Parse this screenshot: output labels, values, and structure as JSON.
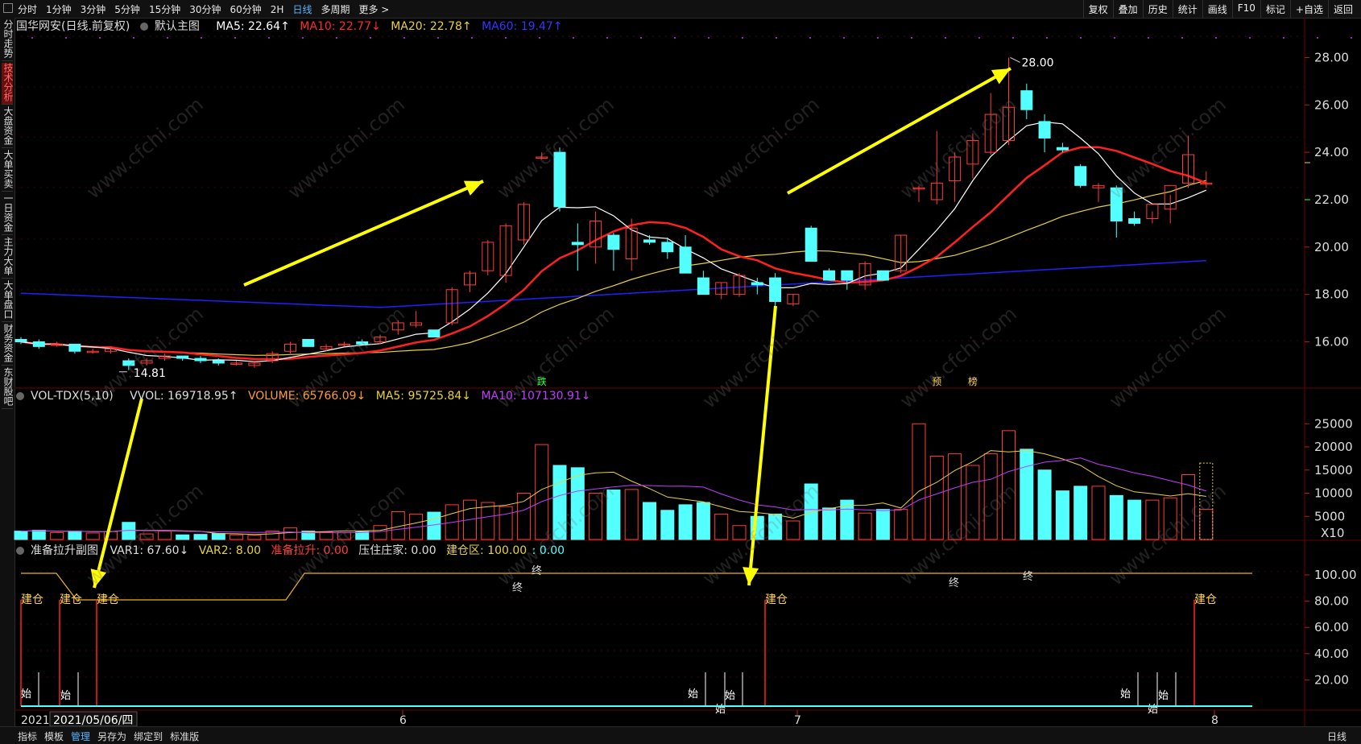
{
  "toolbar": {
    "periods": [
      "分时",
      "1分钟",
      "3分钟",
      "5分钟",
      "15分钟",
      "30分钟",
      "60分钟",
      "2H",
      "日线",
      "多周期",
      "更多 >"
    ],
    "active_period": "日线",
    "actions": [
      "复权",
      "叠加",
      "历史",
      "统计",
      "画线",
      "F10",
      "标记",
      "+自选",
      "返回"
    ]
  },
  "sidebar": {
    "items": [
      "分时走势",
      "技术分析",
      "大盘资金",
      "大单买卖",
      "一日资金",
      "主力大单",
      "大单盘口",
      "财务资金",
      "东财股吧"
    ],
    "active": "技术分析"
  },
  "main_legend": {
    "title": "国华网安(日线.前复权)",
    "template": "默认主图",
    "ma5": "MA5: 22.64↑",
    "ma10": "MA10: 22.77↓",
    "ma20": "MA20: 22.78↑",
    "ma60": "MA60: 19.47↑"
  },
  "vol_legend": {
    "name": "VOL-TDX(5,10)",
    "vvol": "VVOL: 169718.95↑",
    "volume": "VOLUME: 65766.09↓",
    "ma5": "MA5: 95725.84↓",
    "ma10": "MA10: 107130.91↓"
  },
  "sub_legend": {
    "name": "准备拉升副图",
    "var1": "VAR1: 67.60↓",
    "var2": "VAR2: 8.00",
    "zbls": "准备拉升: 0.00",
    "yzzj": "压住庄家: 0.00",
    "jcq": "建仓区: 100.00",
    "extra": ": 0.00"
  },
  "price_axis": [
    "28.00",
    "26.00",
    "24.00",
    "22.00",
    "20.00",
    "18.00",
    "16.00"
  ],
  "vol_axis": [
    "25000",
    "20000",
    "15000",
    "10000",
    "5000",
    "X10"
  ],
  "sub_axis": [
    "100.00",
    "80.00",
    "60.00",
    "40.00",
    "20.00"
  ],
  "annotations": {
    "high": "28.00",
    "low": "14.81",
    "signals": [
      {
        "text": "跌",
        "color": "#3cff3c"
      },
      {
        "text": "预",
        "color": "#ffd24a"
      },
      {
        "text": "榜",
        "color": "#ffd24a"
      }
    ],
    "build": "建仓",
    "start": "始",
    "end": "终"
  },
  "date_axis": {
    "cursor_date": "2021/05/06/四",
    "first": "2021",
    "months": [
      "6",
      "7",
      "8"
    ],
    "period_label": "日线"
  },
  "bottom_tools": [
    "指标",
    "模板",
    "管理",
    "另存为",
    "绑定到",
    "标准版"
  ],
  "bottom_active": "管理",
  "watermark": "www.cfchi.com",
  "colors": {
    "up": "#ff3b3b",
    "down": "#54ffff",
    "ma5": "#ffffff",
    "ma10": "#ff2020",
    "ma20": "#e8d23a",
    "ma60": "#2020ff",
    "arrow": "#ffff00",
    "vol_ma10": "#c03cff"
  },
  "chart_data": {
    "type": "candlestick",
    "candles": [
      [
        16.1,
        16.2,
        15.9,
        16.0
      ],
      [
        16.0,
        16.1,
        15.7,
        15.8
      ],
      [
        15.9,
        16.0,
        15.8,
        15.9
      ],
      [
        15.9,
        15.9,
        15.5,
        15.6
      ],
      [
        15.6,
        15.7,
        15.5,
        15.6
      ],
      [
        15.6,
        15.8,
        15.5,
        15.7
      ],
      [
        15.2,
        15.3,
        14.8,
        15.0
      ],
      [
        15.1,
        15.3,
        15.0,
        15.2
      ],
      [
        15.3,
        15.5,
        15.2,
        15.4
      ],
      [
        15.4,
        15.4,
        15.2,
        15.3
      ],
      [
        15.3,
        15.4,
        15.1,
        15.2
      ],
      [
        15.2,
        15.3,
        15.0,
        15.1
      ],
      [
        15.1,
        15.2,
        15.0,
        15.1
      ],
      [
        15.0,
        15.2,
        14.9,
        15.1
      ],
      [
        15.2,
        15.6,
        15.1,
        15.5
      ],
      [
        15.6,
        16.0,
        15.5,
        15.9
      ],
      [
        16.1,
        16.1,
        15.8,
        15.8
      ],
      [
        15.7,
        15.9,
        15.6,
        15.8
      ],
      [
        15.9,
        16.0,
        15.8,
        15.9
      ],
      [
        16.0,
        16.1,
        15.9,
        15.9
      ],
      [
        16.0,
        16.3,
        15.9,
        16.2
      ],
      [
        16.5,
        16.9,
        16.3,
        16.8
      ],
      [
        16.7,
        17.3,
        16.6,
        16.8
      ],
      [
        16.5,
        16.5,
        16.2,
        16.2
      ],
      [
        16.8,
        18.3,
        16.7,
        18.2
      ],
      [
        18.4,
        19.0,
        18.1,
        18.9
      ],
      [
        19.0,
        20.3,
        18.8,
        20.2
      ],
      [
        18.8,
        21.0,
        18.5,
        20.9
      ],
      [
        20.3,
        21.9,
        20.1,
        21.8
      ],
      [
        23.8,
        24.0,
        23.7,
        23.8
      ],
      [
        24.0,
        24.2,
        21.5,
        21.7
      ],
      [
        20.2,
        21.0,
        19.0,
        20.1
      ],
      [
        20.0,
        21.5,
        19.3,
        21.1
      ],
      [
        20.5,
        20.6,
        19.0,
        19.9
      ],
      [
        19.5,
        21.2,
        19.0,
        20.8
      ],
      [
        20.3,
        20.5,
        20.1,
        20.2
      ],
      [
        20.2,
        20.4,
        19.5,
        19.8
      ],
      [
        20.0,
        20.5,
        18.9,
        18.9
      ],
      [
        18.7,
        19.0,
        18.0,
        18.0
      ],
      [
        18.0,
        18.5,
        17.8,
        18.5
      ],
      [
        18.0,
        18.9,
        17.9,
        18.8
      ],
      [
        18.5,
        18.7,
        18.0,
        18.4
      ],
      [
        18.7,
        18.9,
        17.5,
        17.7
      ],
      [
        17.6,
        18.0,
        17.5,
        18.0
      ],
      [
        20.8,
        20.9,
        19.4,
        19.4
      ],
      [
        19.0,
        19.1,
        18.6,
        18.6
      ],
      [
        19.0,
        19.0,
        18.2,
        18.6
      ],
      [
        18.4,
        19.4,
        18.2,
        19.3
      ],
      [
        19.0,
        19.0,
        18.6,
        18.6
      ],
      [
        19.0,
        20.5,
        18.9,
        20.5
      ],
      [
        22.5,
        22.6,
        21.9,
        22.5
      ],
      [
        22.0,
        24.9,
        21.8,
        22.7
      ],
      [
        22.8,
        24.0,
        21.9,
        23.8
      ],
      [
        23.5,
        24.8,
        22.9,
        24.5
      ],
      [
        24.0,
        26.5,
        23.9,
        25.6
      ],
      [
        24.5,
        28.0,
        24.3,
        25.9
      ],
      [
        26.6,
        26.9,
        25.4,
        25.8
      ],
      [
        25.3,
        25.6,
        24.0,
        24.6
      ],
      [
        24.2,
        24.4,
        24.0,
        24.1
      ],
      [
        23.4,
        23.5,
        22.5,
        22.6
      ],
      [
        22.5,
        22.7,
        21.9,
        22.6
      ],
      [
        22.5,
        22.6,
        20.4,
        21.1
      ],
      [
        21.2,
        21.5,
        20.9,
        21.0
      ],
      [
        21.2,
        21.5,
        21.0,
        21.8
      ],
      [
        21.6,
        22.2,
        21.0,
        22.6
      ],
      [
        22.7,
        24.7,
        22.5,
        23.9
      ],
      [
        22.7,
        23.2,
        22.5,
        22.7
      ]
    ],
    "volume": [
      18,
      20,
      15,
      18,
      14,
      17,
      37,
      12,
      18,
      10,
      11,
      13,
      10,
      9,
      18,
      25,
      18,
      16,
      15,
      18,
      30,
      60,
      55,
      59,
      75,
      85,
      80,
      71,
      100,
      205,
      160,
      155,
      100,
      107,
      108,
      80,
      63,
      75,
      80,
      55,
      30,
      50,
      55,
      40,
      120,
      68,
      85,
      57,
      65,
      65,
      250,
      180,
      185,
      160,
      185,
      235,
      195,
      150,
      105,
      115,
      115,
      95,
      85,
      85,
      90,
      140,
      65
    ],
    "vol_unit": "X10",
    "series_names": [
      "MA5",
      "MA10",
      "MA20",
      "MA60"
    ]
  }
}
